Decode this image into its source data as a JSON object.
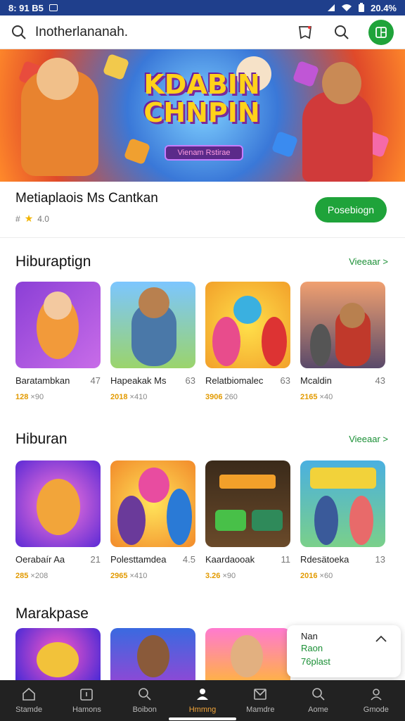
{
  "status": {
    "time": "8: 91 B5",
    "battery": "20.4%"
  },
  "search": {
    "query": "Inotherlananah."
  },
  "hero": {
    "title_line1": "KDABIN",
    "title_line2": "CHNPIN",
    "subtitle": "Vienam Rstirae"
  },
  "app": {
    "name": "Metiaplaois Ms Cantkan",
    "rating": "4.0",
    "install_label": "Posebiogn"
  },
  "sections": [
    {
      "title": "Hiburaptign",
      "link": "Vieeaar >",
      "items": [
        {
          "title": "Baratambkan",
          "num": "47",
          "meta_bold": "128",
          "meta": "×90"
        },
        {
          "title": "Hapeakak Ms",
          "num": "63",
          "meta_bold": "2018",
          "meta": "×410"
        },
        {
          "title": "Relatbiomalec",
          "num": "63",
          "meta_bold": "3906",
          "meta": "260"
        },
        {
          "title": "Mcaldin",
          "num": "43",
          "meta_bold": "2165",
          "meta": "×40"
        }
      ]
    },
    {
      "title": "Hiburan",
      "link": "Vieeaar >",
      "items": [
        {
          "title": "Oerabaír Aa",
          "num": "21",
          "meta_bold": "285",
          "meta": "×208"
        },
        {
          "title": "Polesttamdea",
          "num": "4.5",
          "meta_bold": "2965",
          "meta": "×410"
        },
        {
          "title": "Kaardaooak",
          "num": "11",
          "meta_bold": "3.26",
          "meta": "×90"
        },
        {
          "title": "Rdesätoeka",
          "num": "13",
          "meta_bold": "2016",
          "meta": "×60"
        }
      ]
    },
    {
      "title": "Marakpase"
    }
  ],
  "popup": {
    "line1": "Nan",
    "line2": "Raon",
    "line3": "76plast"
  },
  "nav": [
    {
      "label": "Stamde"
    },
    {
      "label": "Hamons"
    },
    {
      "label": "Boibon"
    },
    {
      "label": "Hmmng"
    },
    {
      "label": "Mamdre"
    },
    {
      "label": "Aome"
    },
    {
      "label": "Gmode"
    }
  ],
  "colors": {
    "accent": "#1fa33a",
    "active_nav": "#f2a53a",
    "statusbar": "#1f3f8c",
    "bottomnav": "#222222"
  }
}
